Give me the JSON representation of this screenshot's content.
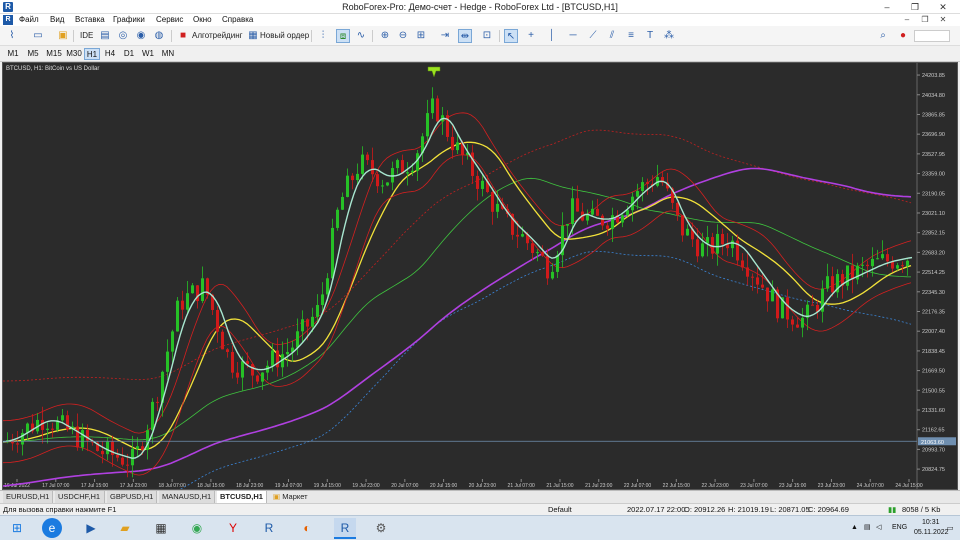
{
  "window": {
    "title": "RoboForex-Pro: Демо-счет - Hedge - RoboForex Ltd - [BTCUSD,H1]",
    "minimize": "–",
    "restore": "❐",
    "close": "✕"
  },
  "menu": {
    "items": [
      "Файл",
      "Вид",
      "Вставка",
      "Графики",
      "Сервис",
      "Окно",
      "Справка"
    ]
  },
  "toolbar": {
    "ide_label": "IDE",
    "algotrading_label": "Алготрейдинг",
    "new_order_label": "Новый ордер"
  },
  "timeframes": {
    "items": [
      "M1",
      "M5",
      "M15",
      "M30",
      "H1",
      "H4",
      "D1",
      "W1",
      "MN"
    ],
    "active": "H1"
  },
  "chart": {
    "caption": "BTCUSD, H1: BitCoin vs US Dollar",
    "current_price": "21063.60",
    "colors": {
      "background": "#2b2b2b",
      "bull": "#26c126",
      "bear": "#d01a1a",
      "ma_fast": "#a8e6d0",
      "ma_mid": "#f2e23a",
      "ma_slow": "#3fc43f",
      "ma_long": "#b040e0",
      "ma_red": "#d32020",
      "ma_blue_dotted": "#3b85d8",
      "ma_red_dotted": "#c22020",
      "arrow": "#9be21f"
    }
  },
  "chart_data": {
    "type": "candlestick",
    "y_ticks": [
      "24203.85",
      "24034.80",
      "23865.85",
      "23696.90",
      "23527.95",
      "23359.00",
      "23190.05",
      "23021.10",
      "22852.15",
      "22683.20",
      "22514.25",
      "22345.30",
      "22176.35",
      "22007.40",
      "21838.45",
      "21669.50",
      "21500.55",
      "21331.60",
      "21162.65",
      "20993.70",
      "20824.75"
    ],
    "x_ticks": [
      "16 Jul 2022",
      "17 Jul 07:00",
      "17 Jul 15:00",
      "17 Jul 23:00",
      "18 Jul 07:00",
      "18 Jul 15:00",
      "18 Jul 23:00",
      "19 Jul 07:00",
      "19 Jul 15:00",
      "19 Jul 23:00",
      "20 Jul 07:00",
      "20 Jul 15:00",
      "20 Jul 23:00",
      "21 Jul 07:00",
      "21 Jul 15:00",
      "21 Jul 23:00",
      "22 Jul 07:00",
      "22 Jul 15:00",
      "22 Jul 23:00",
      "23 Jul 07:00",
      "23 Jul 15:00",
      "23 Jul 23:00",
      "24 Jul 07:00",
      "24 Jul 15:00"
    ],
    "ylim": [
      20740,
      24290
    ],
    "current_price": 21063.6
  },
  "tabs": {
    "items": [
      "EURUSD,H1",
      "USDCHF,H1",
      "GBPUSD,H1",
      "MANAUSD,H1",
      "BTCUSD,H1",
      "Маркет"
    ],
    "active": "BTCUSD,H1"
  },
  "status": {
    "help": "Для вызова справки нажмите F1",
    "profile": "Default",
    "datetime": "2022.07.17 22:00",
    "open": "O: 20912.26",
    "high": "H: 21019.19",
    "low": "L: 20871.05",
    "close": "C: 20964.69",
    "traffic": "8058 / 5 Kb"
  },
  "taskbar": {
    "lang": "ENG",
    "time": "10:31",
    "date": "05.11.2022"
  }
}
